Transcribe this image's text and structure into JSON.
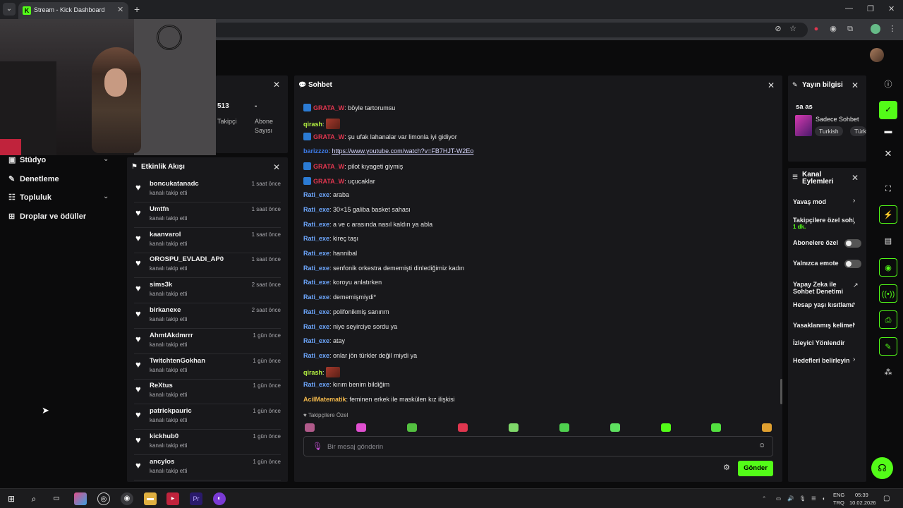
{
  "browser": {
    "tab_title": "Stream - Kick Dashboard",
    "favicon_letter": "K",
    "new_tab": "+",
    "tab_close": "✕"
  },
  "webcam": {},
  "sidebar": {
    "items": [
      {
        "label": "Stüdyo",
        "icon": "video-icon",
        "expandable": true
      },
      {
        "label": "Denetleme",
        "icon": "wrench-icon",
        "expandable": false
      },
      {
        "label": "Topluluk",
        "icon": "users-icon",
        "expandable": true
      },
      {
        "label": "Droplar ve ödüller",
        "icon": "gift-icon",
        "expandable": false
      }
    ]
  },
  "stats": {
    "followers_value": "513",
    "followers_label": "Takipçi",
    "subs_value": "-",
    "subs_label_1": "Abone",
    "subs_label_2": "Sayısı"
  },
  "activity": {
    "title": "Etkinlik Akışı",
    "items": [
      {
        "name": "boncukatanadc",
        "action": "kanalı takip etti",
        "time": "1 saat önce"
      },
      {
        "name": "Umtfn",
        "action": "kanalı takip etti",
        "time": "1 saat önce"
      },
      {
        "name": "kaanvarol",
        "action": "kanalı takip etti",
        "time": "1 saat önce"
      },
      {
        "name": "OROSPU_EVLADI_AP0",
        "action": "kanalı takip etti",
        "time": "1 saat önce"
      },
      {
        "name": "sims3k",
        "action": "kanalı takip etti",
        "time": "2 saat önce"
      },
      {
        "name": "birkanexe",
        "action": "kanalı takip etti",
        "time": "2 saat önce"
      },
      {
        "name": "AhmtAkdmrrr",
        "action": "kanalı takip etti",
        "time": "1 gün önce"
      },
      {
        "name": "TwitchtenGokhan",
        "action": "kanalı takip etti",
        "time": "1 gün önce"
      },
      {
        "name": "ReXtus",
        "action": "kanalı takip etti",
        "time": "1 gün önce"
      },
      {
        "name": "patrickpauric",
        "action": "kanalı takip etti",
        "time": "1 gün önce"
      },
      {
        "name": "kickhub0",
        "action": "kanalı takip etti",
        "time": "1 gün önce"
      },
      {
        "name": "ancylos",
        "action": "kanalı takip etti",
        "time": "1 gün önce"
      }
    ]
  },
  "chat": {
    "title": "Sohbet",
    "messages": [
      {
        "user": "GRATA_W",
        "color": "#e0364f",
        "badge": true,
        "text": "böyle tartorumsu"
      },
      {
        "user": "qirash",
        "color": "#b7f542",
        "badge": false,
        "text": "",
        "emote": true
      },
      {
        "user": "GRATA_W",
        "color": "#e0364f",
        "badge": true,
        "text": "şu ufak lahanalar var limonla iyi gidiyor"
      },
      {
        "user": "barizzzo",
        "color": "#3d7be8",
        "badge": false,
        "text": "https://www.youtube.com/watch?v=FB7HJT-W2Eo",
        "link": true
      },
      {
        "user": "GRATA_W",
        "color": "#e0364f",
        "badge": true,
        "text": "pilot kıyageti giymiş"
      },
      {
        "user": "GRATA_W",
        "color": "#e0364f",
        "badge": true,
        "text": "uçucaklar"
      },
      {
        "user": "Rati_exe",
        "color": "#6ea8ff",
        "badge": false,
        "text": "araba"
      },
      {
        "user": "Rati_exe",
        "color": "#6ea8ff",
        "badge": false,
        "text": "30×15 galiba basket sahası"
      },
      {
        "user": "Rati_exe",
        "color": "#6ea8ff",
        "badge": false,
        "text": "a ve c arasında nasıl kaldın ya abla"
      },
      {
        "user": "Rati_exe",
        "color": "#6ea8ff",
        "badge": false,
        "text": "kireç taşı"
      },
      {
        "user": "Rati_exe",
        "color": "#6ea8ff",
        "badge": false,
        "text": "hannibal"
      },
      {
        "user": "Rati_exe",
        "color": "#6ea8ff",
        "badge": false,
        "text": "senfonik orkestra dememişti dinlediğimiz kadın"
      },
      {
        "user": "Rati_exe",
        "color": "#6ea8ff",
        "badge": false,
        "text": "koroyu anlatırken"
      },
      {
        "user": "Rati_exe",
        "color": "#6ea8ff",
        "badge": false,
        "text": "dememişmiydi*"
      },
      {
        "user": "Rati_exe",
        "color": "#6ea8ff",
        "badge": false,
        "text": "polifonikmiş sanırım"
      },
      {
        "user": "Rati_exe",
        "color": "#6ea8ff",
        "badge": false,
        "text": "niye seyirciye sordu ya"
      },
      {
        "user": "Rati_exe",
        "color": "#6ea8ff",
        "badge": false,
        "text": "atay"
      },
      {
        "user": "Rati_exe",
        "color": "#6ea8ff",
        "badge": false,
        "text": "onlar jön türkler değil miydi ya"
      },
      {
        "user": "qirash",
        "color": "#b7f542",
        "badge": false,
        "text": "",
        "emote": true
      },
      {
        "user": "Rati_exe",
        "color": "#6ea8ff",
        "badge": false,
        "text": "kırım benim bildiğim"
      },
      {
        "user": "AcilMatematik",
        "color": "#f2b84b",
        "badge": false,
        "text": "feminen erkek ile maskülen kız ilişkisi"
      }
    ],
    "followers_only_label": "Takipçilere Özel",
    "input_placeholder": "Bir mesaj gönderin",
    "send_label": "Gönder"
  },
  "stream_info": {
    "title": "Yayın bilgisi",
    "stream_title": "sa as",
    "category": "Sadece Sohbet",
    "tags": [
      "Turkish",
      "Türkçe"
    ]
  },
  "channel_actions": {
    "title_1": "Kanal",
    "title_2": "Eylemleri",
    "items": [
      {
        "label": "Yavaş mod",
        "kind": "chevron"
      },
      {
        "label": "Takipçilere özel sohbet",
        "kind": "chevron",
        "sub": "1 dk."
      },
      {
        "label": "Abonelere özel",
        "kind": "toggle"
      },
      {
        "label": "Yalnızca emote",
        "kind": "toggle"
      },
      {
        "label": "Yapay Zeka ile Sohbet Denetimi",
        "kind": "external"
      },
      {
        "label": "Hesap yaşı kısıtlaması",
        "kind": "chevron"
      },
      {
        "label": "Yasaklanmış kelimeler",
        "kind": "chevron"
      },
      {
        "label": "İzleyici Yönlendir",
        "kind": "none"
      },
      {
        "label": "Hedefleri belirleyin",
        "kind": "chevron"
      }
    ]
  },
  "taskbar": {
    "lang_1": "ENG",
    "lang_2": "TRQ",
    "time": "05:39",
    "date": "10.02.2026"
  },
  "colors": {
    "accent": "#53fc18",
    "panel_bg": "#18181b"
  }
}
